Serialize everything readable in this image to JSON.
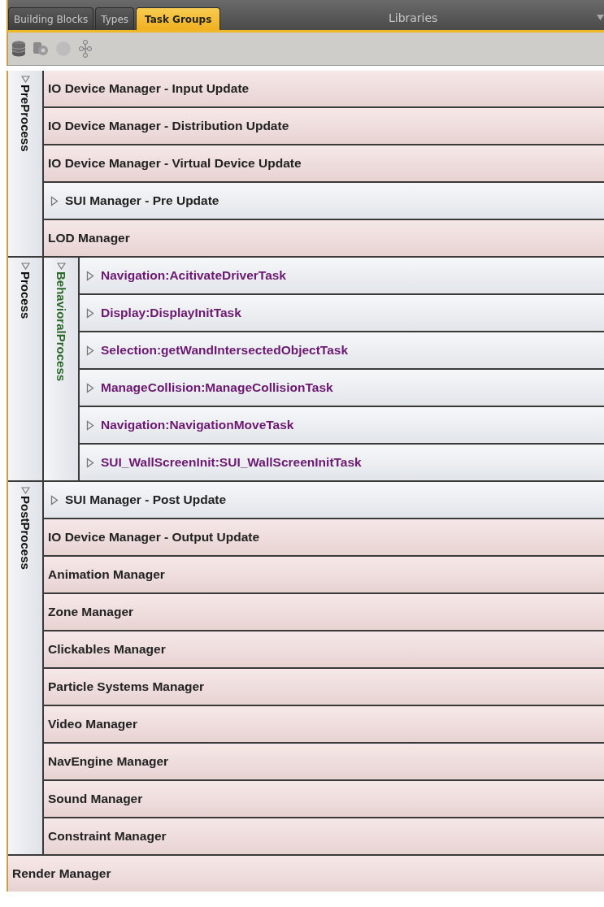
{
  "tabs": [
    {
      "label": "Building Blocks",
      "selected": false
    },
    {
      "label": "Types",
      "selected": false
    },
    {
      "label": "Task Groups",
      "selected": true
    }
  ],
  "libraries_title": "Libraries",
  "tree": [
    {
      "kind": "group",
      "label": "PreProcess",
      "expanded": true,
      "children": [
        {
          "kind": "manager",
          "label": "IO Device Manager - Input Update"
        },
        {
          "kind": "manager",
          "label": "IO Device Manager - Distribution Update"
        },
        {
          "kind": "manager",
          "label": "IO Device Manager - Virtual Device Update"
        },
        {
          "kind": "subgraph",
          "label": "SUI Manager - Pre Update",
          "expanded": false
        },
        {
          "kind": "manager",
          "label": "LOD Manager"
        }
      ]
    },
    {
      "kind": "group",
      "label": "Process",
      "expanded": true,
      "children": [
        {
          "kind": "behavior_group",
          "label": "BehavioralProcess",
          "expanded": true,
          "children": [
            {
              "kind": "script",
              "label": "Navigation:AcitivateDriverTask",
              "expanded": false
            },
            {
              "kind": "script",
              "label": "Display:DisplayInitTask",
              "expanded": false
            },
            {
              "kind": "script",
              "label": "Selection:getWandIntersectedObjectTask",
              "expanded": false
            },
            {
              "kind": "script",
              "label": "ManageCollision:ManageCollisionTask",
              "expanded": false
            },
            {
              "kind": "script",
              "label": "Navigation:NavigationMoveTask",
              "expanded": false
            },
            {
              "kind": "script",
              "label": "SUI_WallScreenInit:SUI_WallScreenInitTask",
              "expanded": false
            }
          ]
        }
      ]
    },
    {
      "kind": "group",
      "label": "PostProcess",
      "expanded": true,
      "children": [
        {
          "kind": "subgraph",
          "label": "SUI Manager - Post Update",
          "expanded": false
        },
        {
          "kind": "manager",
          "label": "IO Device Manager - Output Update"
        },
        {
          "kind": "manager",
          "label": "Animation Manager"
        },
        {
          "kind": "manager",
          "label": "Zone Manager"
        },
        {
          "kind": "manager",
          "label": "Clickables Manager"
        },
        {
          "kind": "manager",
          "label": "Particle Systems Manager"
        },
        {
          "kind": "manager",
          "label": "Video Manager"
        },
        {
          "kind": "manager",
          "label": "NavEngine Manager"
        },
        {
          "kind": "manager",
          "label": "Sound Manager"
        },
        {
          "kind": "manager",
          "label": "Constraint Manager"
        }
      ]
    },
    {
      "kind": "manager",
      "label": "Render Manager"
    }
  ]
}
